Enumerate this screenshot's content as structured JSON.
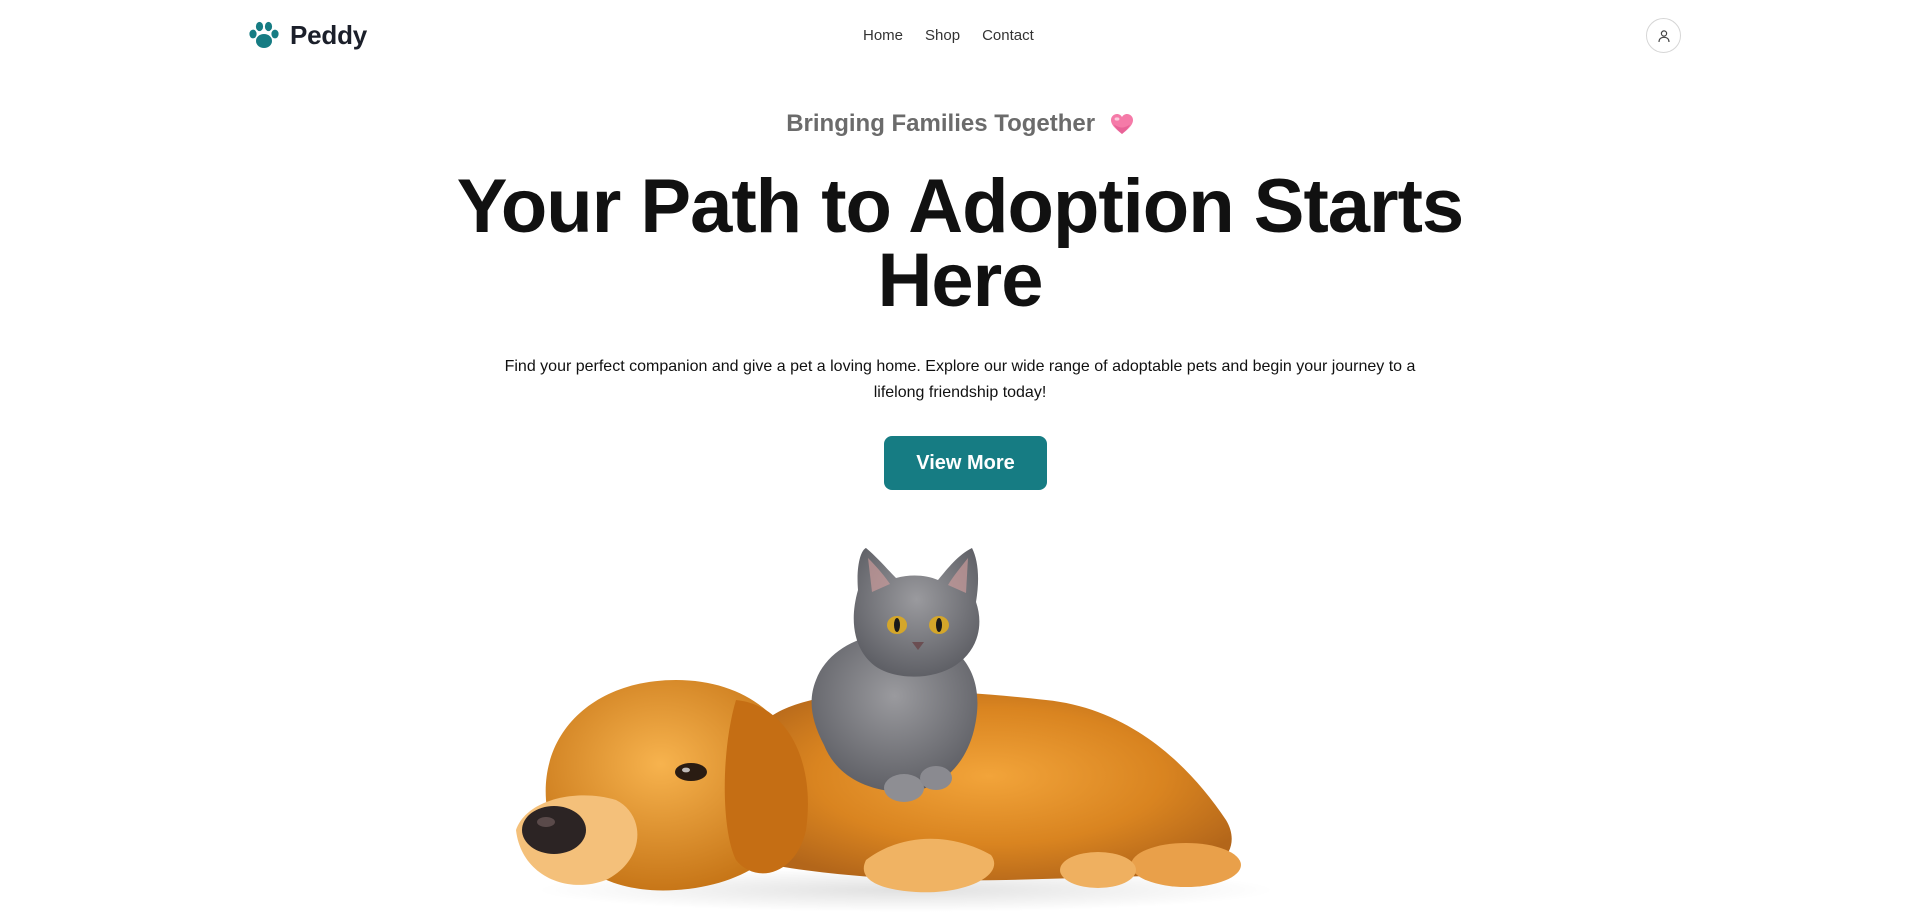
{
  "header": {
    "brand": "Peddy",
    "nav": [
      "Home",
      "Shop",
      "Contact"
    ],
    "user_icon": "user-icon",
    "logo_icon": "paw-icon"
  },
  "hero": {
    "tagline": "Bringing Families Together",
    "tagline_icon": "heart-icon",
    "title_line1": "Your Path to Adoption Starts",
    "title_line2": "Here",
    "description": "Find your perfect companion and give a pet a loving home. Explore our wide range of adoptable pets and begin your journey to a lifelong friendship today!",
    "cta_label": "View More",
    "image_alt": "golden retriever dog lying with a grey kitten on its back"
  },
  "colors": {
    "brand": "#167c83",
    "heading": "#111111",
    "tagline": "#6b6b6b"
  }
}
